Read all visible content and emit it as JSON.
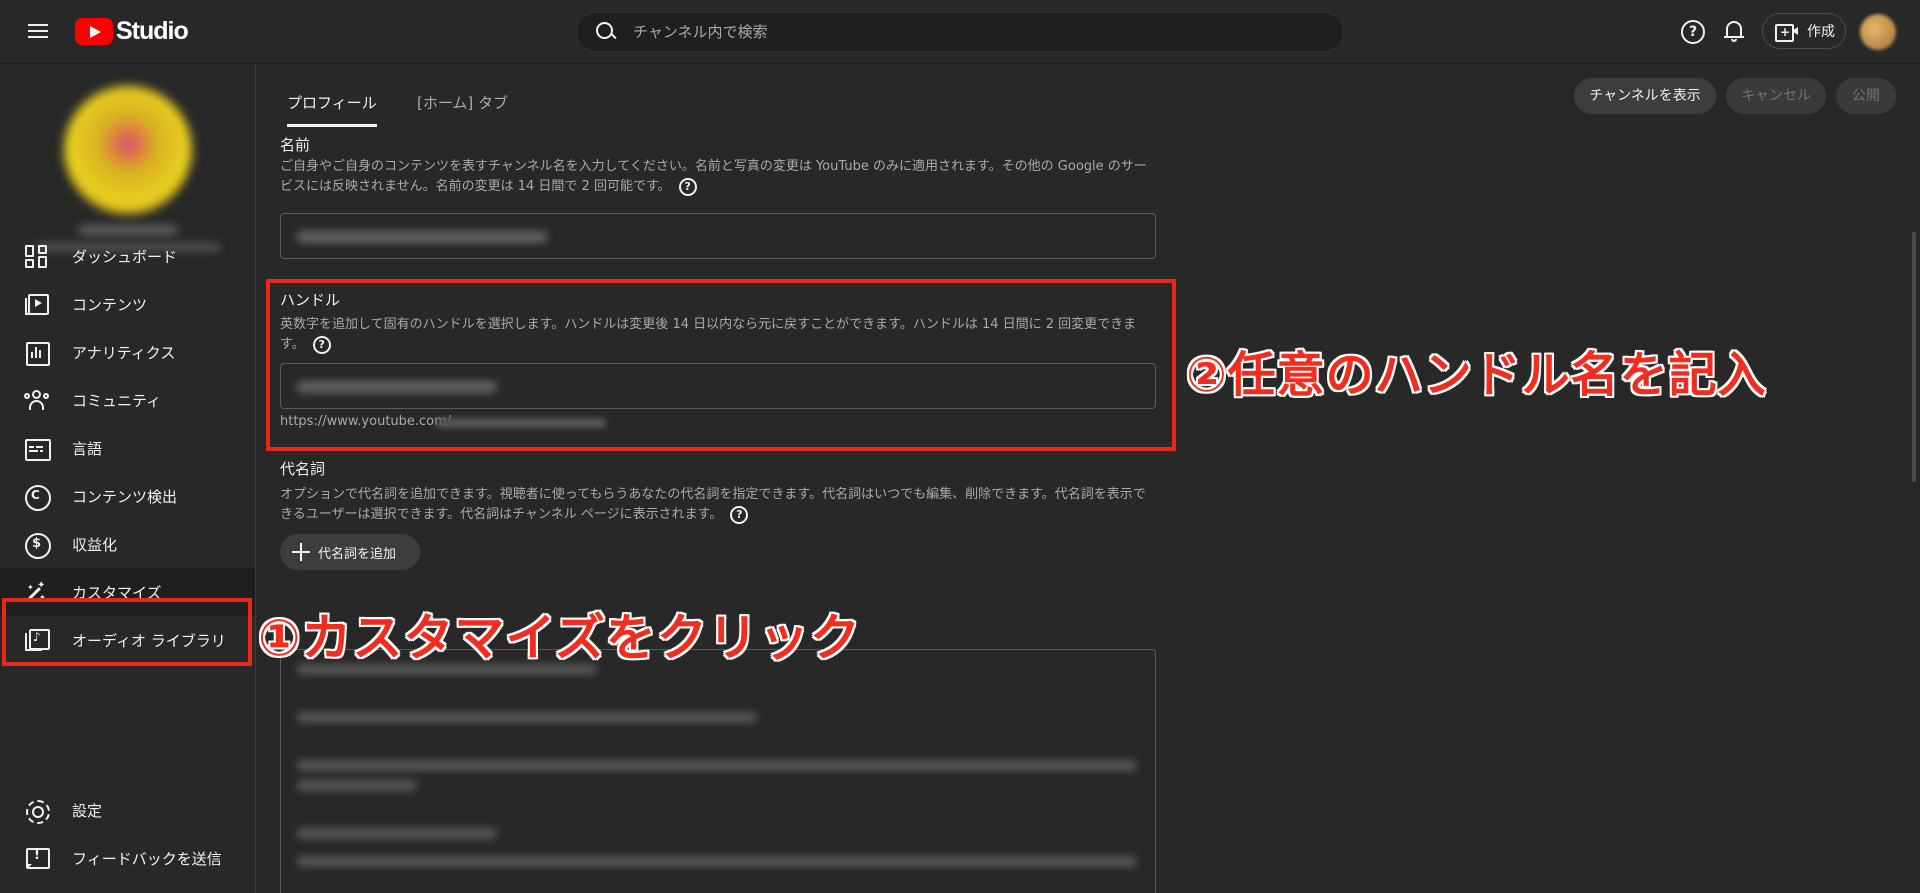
{
  "app": {
    "logo_text": "Studio",
    "search_placeholder": "チャンネル内で検索",
    "create_label": "作成"
  },
  "sidebar": {
    "items": [
      {
        "label": "ダッシュボード",
        "icon": "dashboard-icon"
      },
      {
        "label": "コンテンツ",
        "icon": "content-icon"
      },
      {
        "label": "アナリティクス",
        "icon": "analytics-icon"
      },
      {
        "label": "コミュニティ",
        "icon": "community-icon"
      },
      {
        "label": "言語",
        "icon": "subtitles-icon"
      },
      {
        "label": "コンテンツ検出",
        "icon": "copyright-icon"
      },
      {
        "label": "収益化",
        "icon": "monetization-icon"
      },
      {
        "label": "カスタマイズ",
        "icon": "magic-wand-icon",
        "active": true
      },
      {
        "label": "オーディオ ライブラリ",
        "icon": "audio-library-icon"
      }
    ],
    "bottom_items": [
      {
        "label": "設定",
        "icon": "gear-icon"
      },
      {
        "label": "フィードバックを送信",
        "icon": "feedback-icon"
      }
    ]
  },
  "tabs": {
    "profile": "プロフィール",
    "home": "[ホーム] タブ"
  },
  "actions": {
    "view_channel": "チャンネルを表示",
    "cancel": "キャンセル",
    "publish": "公開"
  },
  "name_section": {
    "title": "名前",
    "description": "ご自身やご自身のコンテンツを表すチャンネル名を入力してください。名前と写真の変更は YouTube のみに適用されます。その他の Google のサービスには反映されません。名前の変更は 14 日間で 2 回可能です。"
  },
  "handle_section": {
    "title": "ハンドル",
    "description": "英数字を追加して固有のハンドルを選択します。ハンドルは変更後 14 日以内なら元に戻すことができます。ハンドルは 14 日間に 2 回変更できます。",
    "url_prefix": "https://www.youtube.com/"
  },
  "pronoun_section": {
    "title": "代名詞",
    "description": "オプションで代名詞を追加できます。視聴者に使ってもらうあなたの代名詞を指定できます。代名詞はいつでも編集、削除できます。代名詞を表示できるユーザーは選択できます。代名詞はチャンネル ページに表示されます。",
    "add_button": "代名詞を追加"
  },
  "annotations": {
    "step1": "①カスタマイズをクリック",
    "step2": "②任意のハンドル名を記入",
    "color": "#e8261a"
  }
}
